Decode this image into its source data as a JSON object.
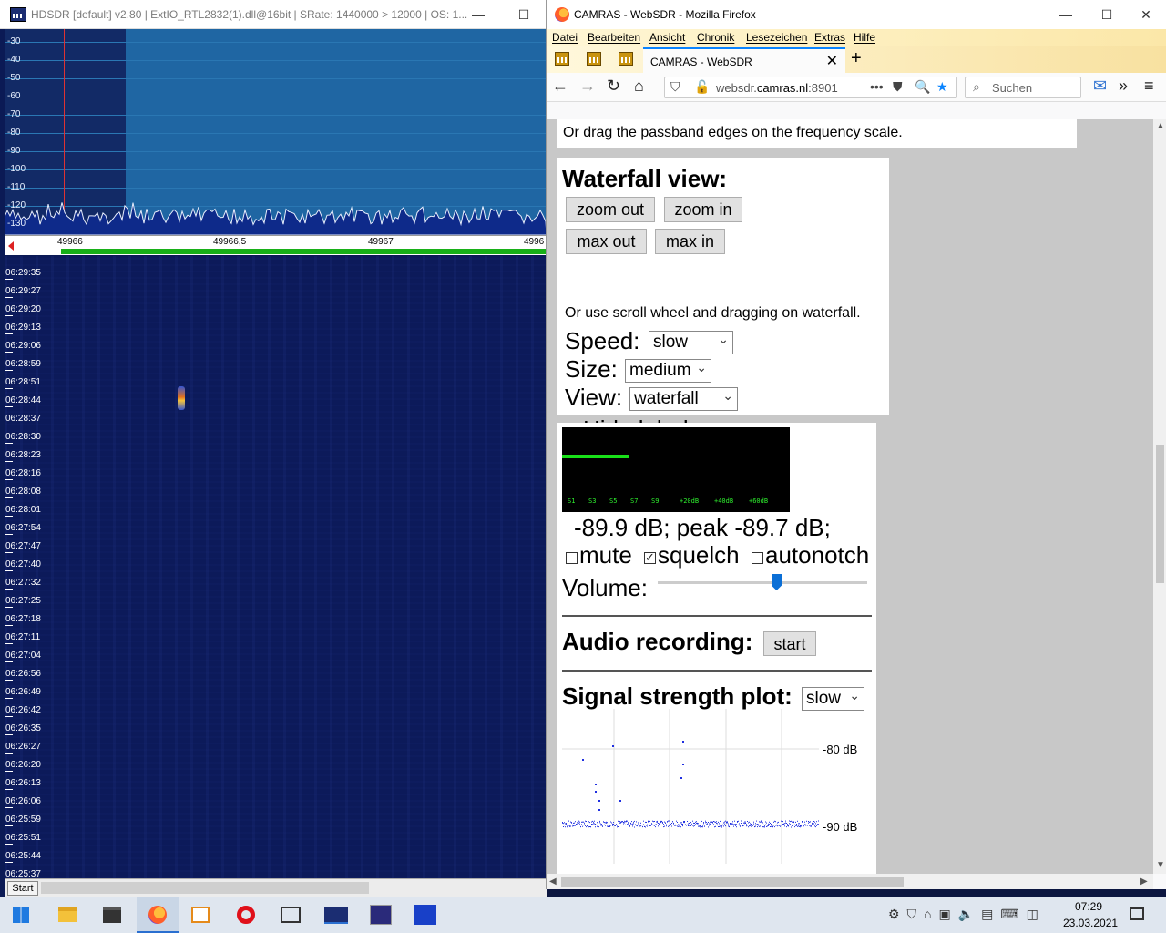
{
  "hdsdr": {
    "title": "HDSDR  [default]  v2.80  |  ExtIO_RTL2832(1).dll@16bit  |  SRate: 1440000 > 12000  |  OS: 1...",
    "db_scale": [
      "-30",
      "-40",
      "-50",
      "-60",
      "-70",
      "-80",
      "-90",
      "-100",
      "-110",
      "-120",
      "-130"
    ],
    "freq_labels": [
      "49966",
      "49966,5",
      "49967",
      "4996"
    ],
    "times": [
      "06:29:35",
      "06:29:27",
      "06:29:20",
      "06:29:13",
      "06:29:06",
      "06:28:59",
      "06:28:51",
      "06:28:44",
      "06:28:37",
      "06:28:30",
      "06:28:23",
      "06:28:16",
      "06:28:08",
      "06:28:01",
      "06:27:54",
      "06:27:47",
      "06:27:40",
      "06:27:32",
      "06:27:25",
      "06:27:18",
      "06:27:11",
      "06:27:04",
      "06:26:56",
      "06:26:49",
      "06:26:42",
      "06:26:35",
      "06:26:27",
      "06:26:20",
      "06:26:13",
      "06:26:06",
      "06:25:59",
      "06:25:51",
      "06:25:44",
      "06:25:37"
    ],
    "start_label": "Start",
    "window_buttons": [
      "—",
      "☐"
    ]
  },
  "firefox": {
    "title": "CAMRAS - WebSDR - Mozilla Firefox",
    "window_buttons": [
      "—",
      "☐",
      "✕"
    ],
    "menu": [
      "Datei",
      "Bearbeiten",
      "Ansicht",
      "Chronik",
      "Lesezeichen",
      "Extras",
      "Hilfe"
    ],
    "tab_title": "CAMRAS - WebSDR",
    "url_prefix": "websdr.",
    "url_host": "camras.nl",
    "url_port": ":8901",
    "search_placeholder": "Suchen"
  },
  "websdr": {
    "passband_note": "Or drag the passband edges on the frequency scale.",
    "waterfall": {
      "heading": "Waterfall view:",
      "zoom_out": "zoom out",
      "zoom_in": "zoom in",
      "max_out": "max out",
      "max_in": "max in",
      "hint": "Or use scroll wheel and dragging on waterfall.",
      "speed_label": "Speed:",
      "speed_value": "slow",
      "size_label": "Size:",
      "size_value": "medium",
      "view_label": "View:",
      "view_value": "waterfall",
      "hide_labels": "Hide labels",
      "hide_labels_checked": false
    },
    "smeter": {
      "scale": [
        "S1",
        "S3",
        "S5",
        "S7",
        "S9",
        "+20dB",
        "+40dB",
        "+60dB"
      ],
      "level_fraction": 0.29,
      "readout": "-89.9 dB; peak   -89.7 dB;",
      "mute": "mute",
      "mute_checked": false,
      "squelch": "squelch",
      "squelch_checked": true,
      "autonotch": "autonotch",
      "autonotch_checked": false,
      "volume_label": "Volume:",
      "volume_fraction": 0.57
    },
    "audio": {
      "heading": "Audio recording:",
      "start_label": "start"
    },
    "signal_plot": {
      "heading": "Signal strength plot:",
      "speed_value": "slow",
      "labels": [
        "-80 dB",
        "-90 dB"
      ]
    }
  },
  "taskbar": {
    "time": "07:29",
    "date": "23.03.2021"
  }
}
